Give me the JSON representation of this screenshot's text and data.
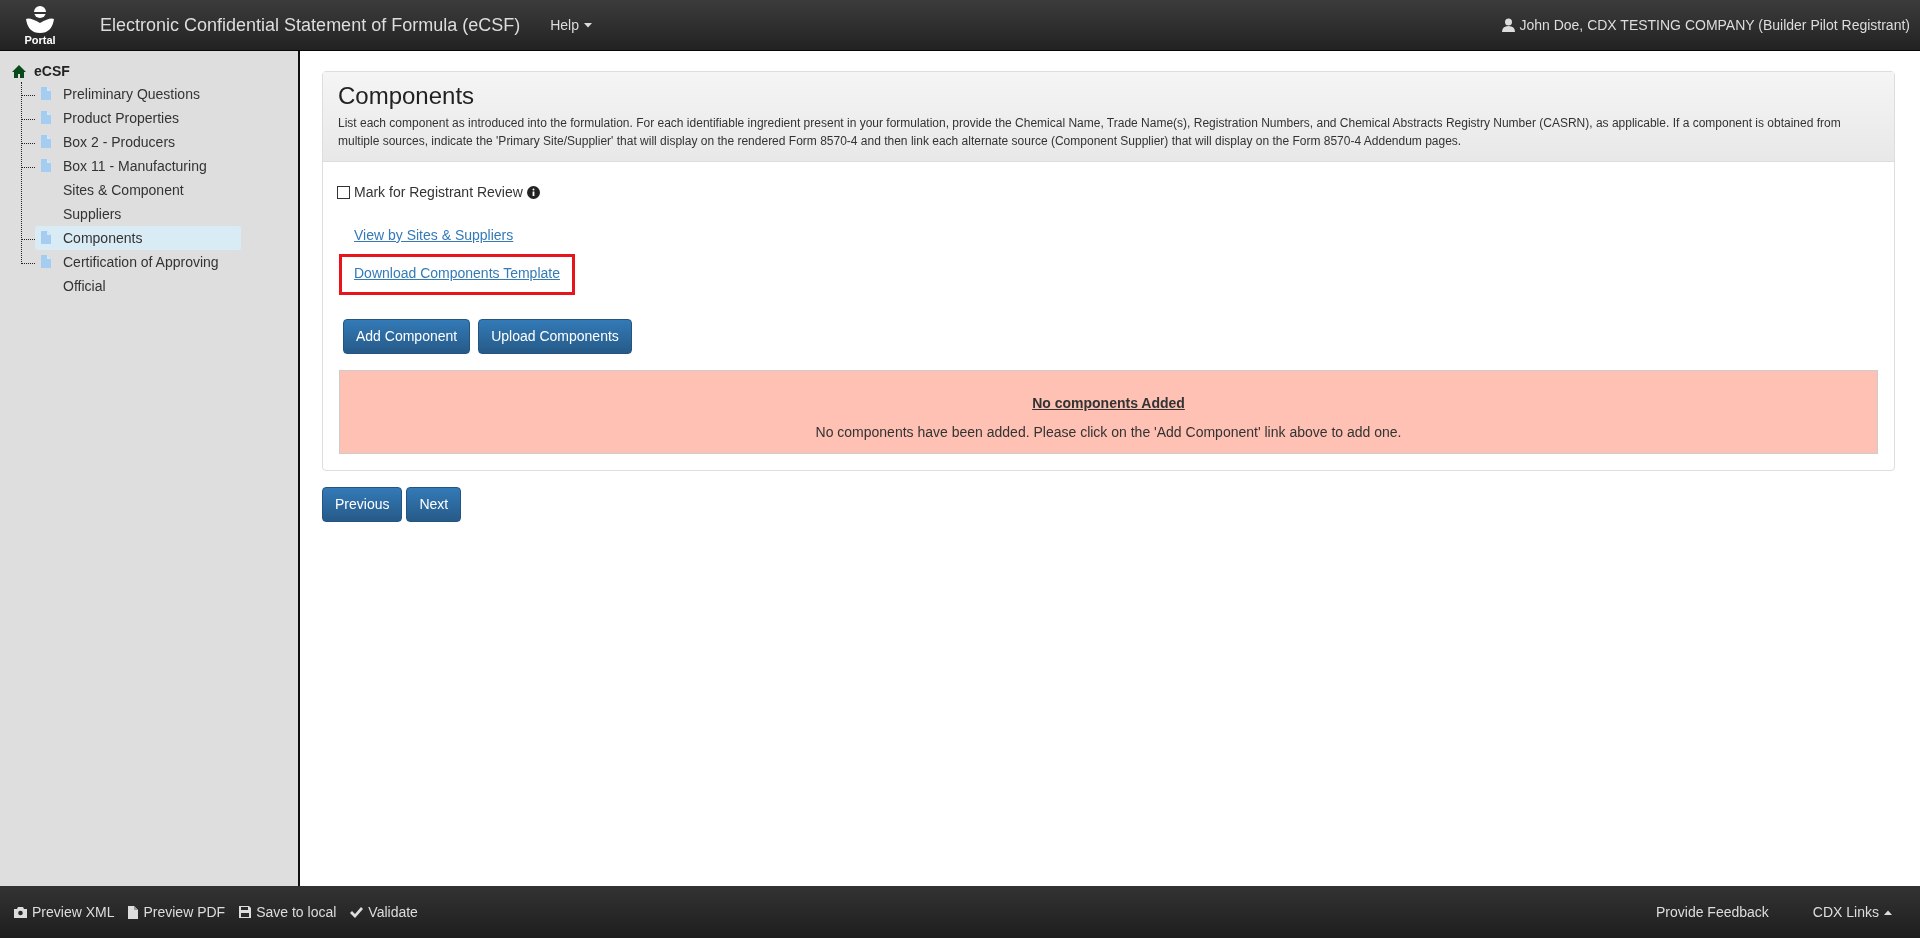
{
  "header": {
    "logo_text": "Portal",
    "title": "Electronic Confidential Statement of Formula (eCSF)",
    "help_menu": "Help",
    "user": "John Doe, CDX TESTING COMPANY (Builder Pilot Registrant)"
  },
  "sidebar": {
    "root": "eCSF",
    "items": [
      {
        "label": "Preliminary Questions",
        "selected": false
      },
      {
        "label": "Product Properties",
        "selected": false
      },
      {
        "label": "Box 2 - Producers",
        "selected": false
      },
      {
        "label": "Box 11 - Manufacturing Sites & Component Suppliers",
        "selected": false
      },
      {
        "label": "Components",
        "selected": true
      },
      {
        "label": "Certification of Approving Official",
        "selected": false
      }
    ]
  },
  "panel": {
    "title": "Components",
    "description": "List each component as introduced into the formulation. For each identifiable ingredient present in your formulation, provide the Chemical Name, Trade Name(s), Registration Numbers, and Chemical Abstracts Registry Number (CASRN), as applicable. If a component is obtained from multiple sources, indicate the 'Primary Site/Supplier' that will display on the rendered Form 8570-4 and then link each alternate source (Component Supplier) that will display on the Form 8570-4 Addendum pages.",
    "review_checkbox": {
      "label": "Mark for Registrant Review",
      "checked": false
    },
    "links": [
      {
        "label": "View by Sites & Suppliers",
        "highlighted": false
      },
      {
        "label": "Download Components Template",
        "highlighted": true
      }
    ],
    "buttons": [
      "Add Component",
      "Upload Components"
    ],
    "alert": {
      "title": "No components Added",
      "message": "No components have been added. Please click on the 'Add Component' link above to add one."
    }
  },
  "nav_buttons": [
    "Previous",
    "Next"
  ],
  "footer": {
    "actions": [
      "Preview XML",
      "Preview PDF",
      "Save to local",
      "Validate"
    ],
    "right": [
      "Provide Feedback",
      "CDX Links"
    ]
  }
}
